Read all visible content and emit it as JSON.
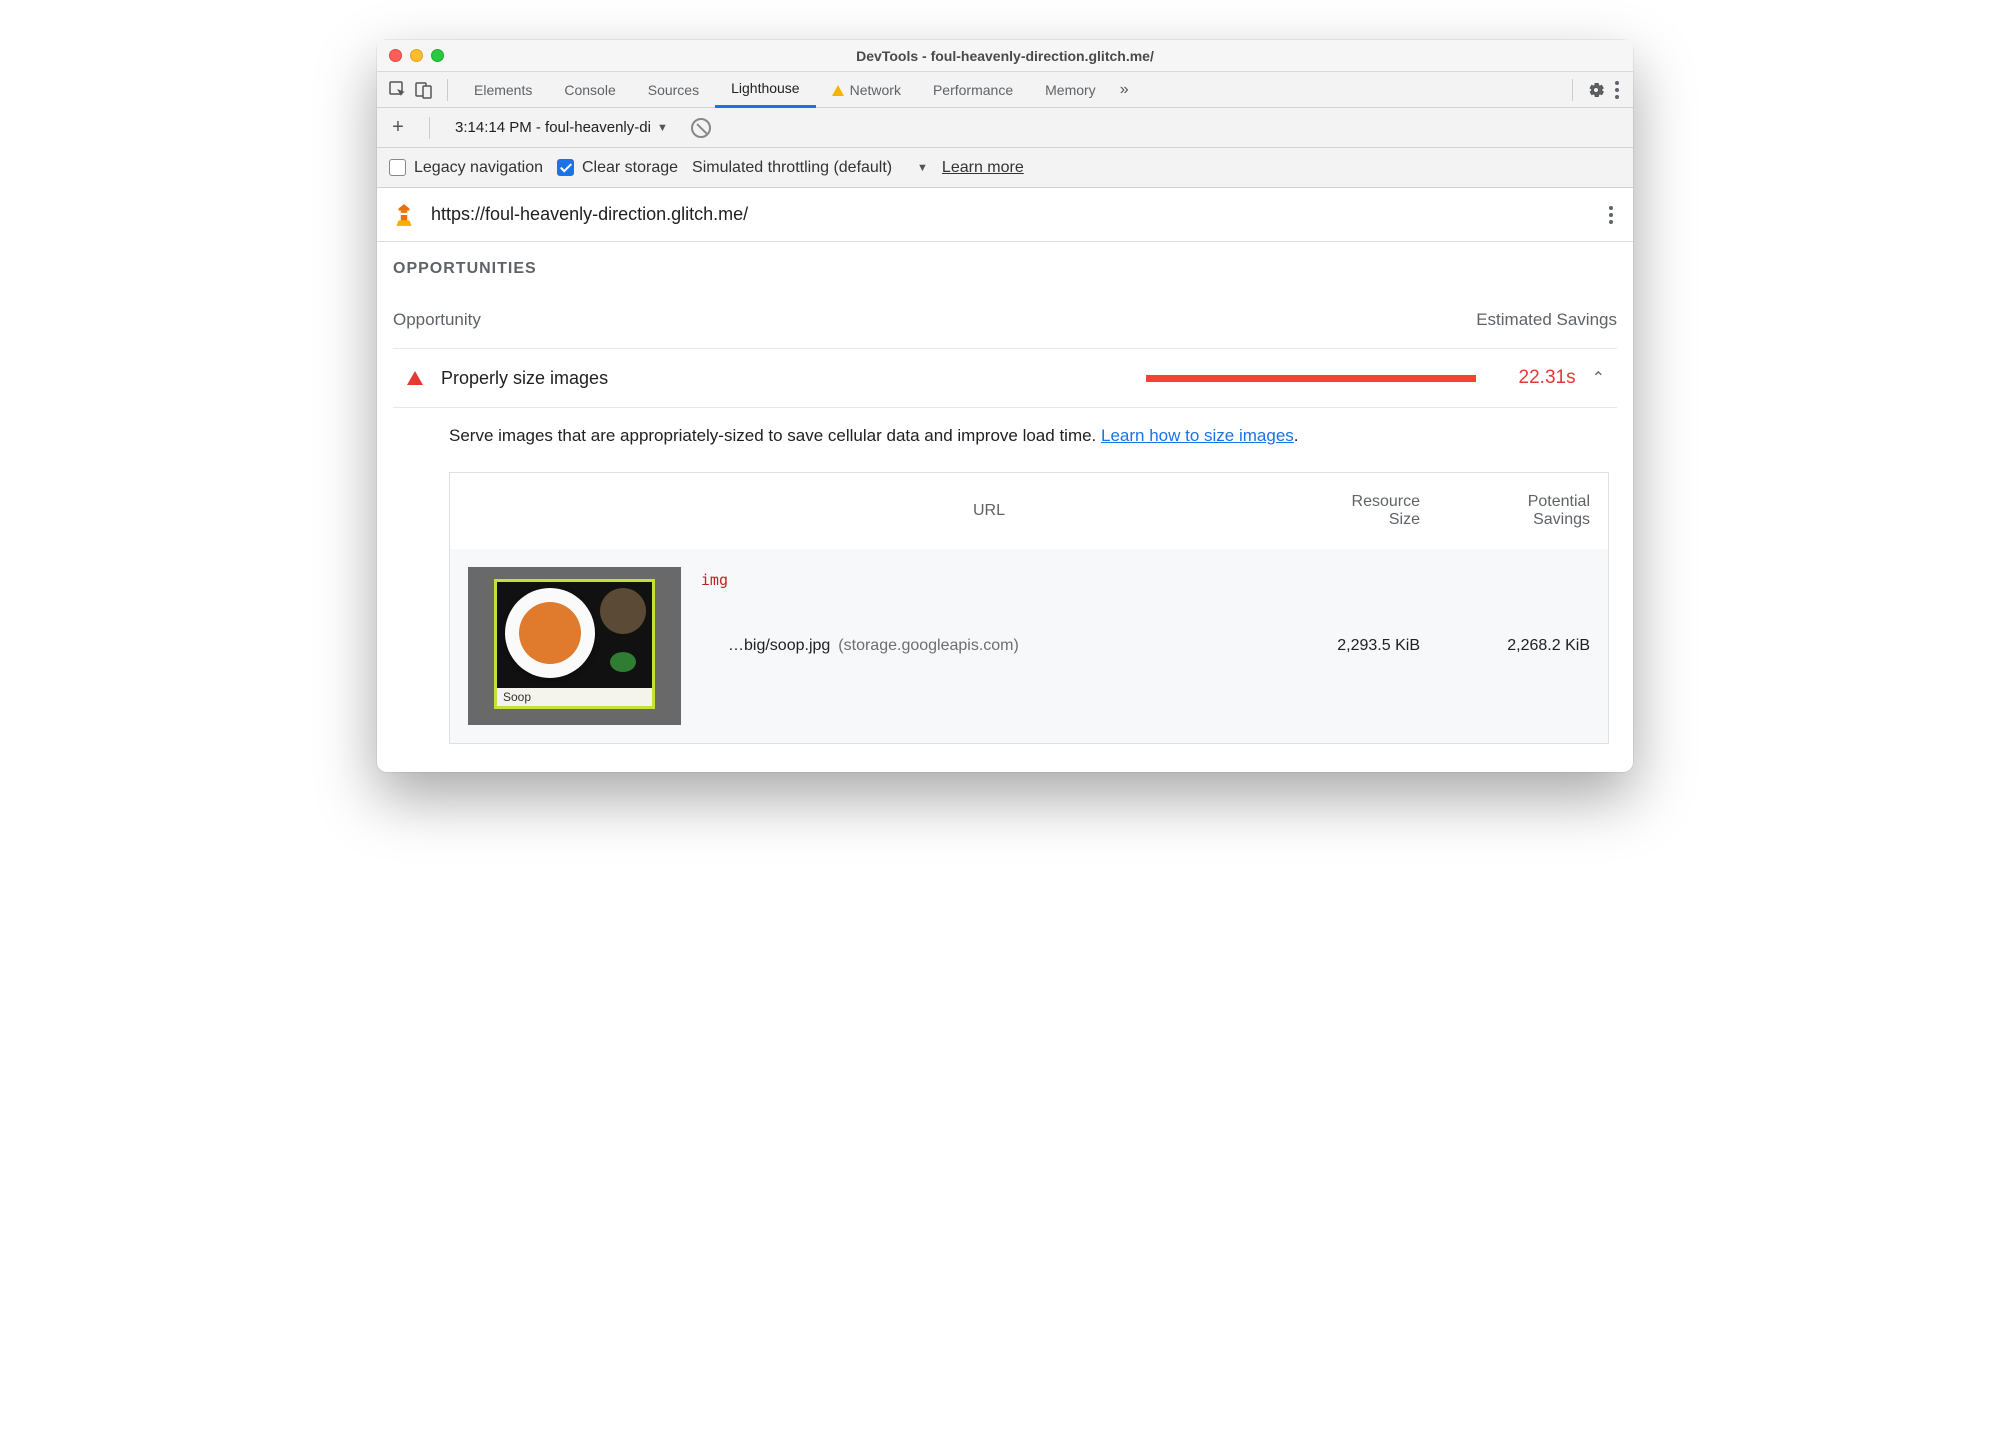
{
  "window": {
    "title": "DevTools - foul-heavenly-direction.glitch.me/"
  },
  "tabs": {
    "items": [
      "Elements",
      "Console",
      "Sources",
      "Lighthouse",
      "Network",
      "Performance",
      "Memory"
    ],
    "active": "Lighthouse",
    "warning": "Network"
  },
  "subbar": {
    "run_label": "3:14:14 PM - foul-heavenly-di"
  },
  "options": {
    "legacy_label": "Legacy navigation",
    "legacy_checked": false,
    "clear_label": "Clear storage",
    "clear_checked": true,
    "throttle_label": "Simulated throttling (default)",
    "learn_more": "Learn more"
  },
  "url_row": {
    "url": "https://foul-heavenly-direction.glitch.me/"
  },
  "section": {
    "header": "OPPORTUNITIES",
    "col_opportunity": "Opportunity",
    "col_savings": "Estimated Savings"
  },
  "opportunity": {
    "title": "Properly size images",
    "savings": "22.31s",
    "description_pre": "Serve images that are appropriately-sized to save cellular data and improve load time. ",
    "description_link": "Learn how to size images",
    "description_post": "."
  },
  "res_table": {
    "col_url": "URL",
    "col_size_l1": "Resource",
    "col_size_l2": "Size",
    "col_sav_l1": "Potential",
    "col_sav_l2": "Savings",
    "rows": [
      {
        "tag": "img",
        "url": "…big/soop.jpg",
        "host": "(storage.googleapis.com)",
        "size": "2,293.5 KiB",
        "savings": "2,268.2 KiB",
        "thumb_caption": "Soop"
      }
    ]
  }
}
